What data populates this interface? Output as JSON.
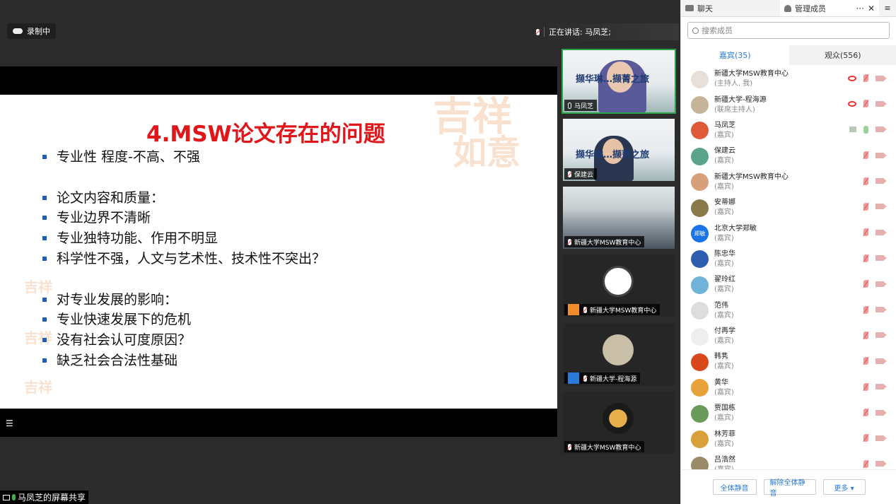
{
  "recording": {
    "label": "录制中"
  },
  "speaking": {
    "label": "正在讲话: 马凤芝;"
  },
  "slide": {
    "title": "4.MSW论文存在的问题",
    "bullets": [
      "专业性   程度-不高、不强",
      "",
      "论文内容和质量：",
      "专业边界不清晰",
      "专业独特功能、作用不明显",
      "科学性不强，人文与艺术性、技术性不突出？",
      "",
      "对专业发展的影响：",
      "专业快速发展下的危机",
      "没有社会认可度原因？",
      "缺乏社会合法性基础"
    ]
  },
  "share": {
    "label": "马凤芝的屏幕共享"
  },
  "videos": [
    {
      "name": "马凤芝",
      "banner": "撷华琳…撷菁之旅"
    },
    {
      "name": "保建云",
      "banner": "撷华琳…撷菁之旅"
    },
    {
      "name": "新疆大学MSW教育中心"
    },
    {
      "name": "新疆大学MSW教育中心"
    },
    {
      "name": "新疆大学-程海源"
    },
    {
      "name": "新疆大学MSW教育中心"
    }
  ],
  "panel": {
    "tab_chat": "聊天",
    "tab_members": "管理成员",
    "more_icon": "···",
    "close_icon": "✕",
    "search_placeholder": "搜索成员",
    "guests_tab": "嘉宾(35)",
    "audience_tab": "观众(556)",
    "members": [
      {
        "name": "新疆大学MSW教育中心",
        "role": "(主持人, 我)",
        "color": "#e8e0d8"
      },
      {
        "name": "新疆大学-程海源",
        "role": "(联席主持人)",
        "color": "#c7b59a"
      },
      {
        "name": "马凤芝",
        "role": "(嘉宾)",
        "color": "#e05a3a"
      },
      {
        "name": "保建云",
        "role": "(嘉宾)",
        "color": "#5aa38c"
      },
      {
        "name": "新疆大学MSW教育中心",
        "role": "(嘉宾)",
        "color": "#d8a07a"
      },
      {
        "name": "安蒂娜",
        "role": "(嘉宾)",
        "color": "#8a7a4a"
      },
      {
        "name": "北京大学郑敏",
        "role": "(嘉宾)",
        "color": "#1a73e8",
        "initials": "郑敏"
      },
      {
        "name": "陈忠华",
        "role": "(嘉宾)",
        "color": "#2d5fb0"
      },
      {
        "name": "翟玲红",
        "role": "(嘉宾)",
        "color": "#6fb3d9"
      },
      {
        "name": "范伟",
        "role": "(嘉宾)",
        "color": "#ddd"
      },
      {
        "name": "付再学",
        "role": "(嘉宾)",
        "color": "#eee"
      },
      {
        "name": "韩隽",
        "role": "(嘉宾)",
        "color": "#d9481a"
      },
      {
        "name": "黄华",
        "role": "(嘉宾)",
        "color": "#e9a23a"
      },
      {
        "name": "贾国栋",
        "role": "(嘉宾)",
        "color": "#6a9a5a"
      },
      {
        "name": "林芳菲",
        "role": "(嘉宾)",
        "color": "#d9a03a"
      },
      {
        "name": "吕浩然",
        "role": "(嘉宾)",
        "color": "#9a8a6a"
      }
    ],
    "btn_mute_all": "全体静音",
    "btn_unmute_all": "解除全体静音",
    "btn_more": "更多 ▾"
  }
}
